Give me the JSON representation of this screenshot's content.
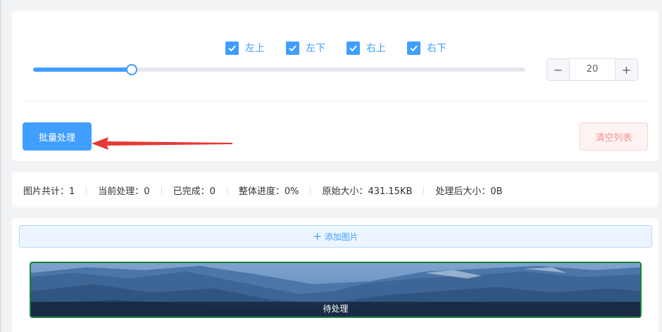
{
  "options": {
    "checkboxes": [
      {
        "label": "左上",
        "checked": true
      },
      {
        "label": "左下",
        "checked": true
      },
      {
        "label": "右上",
        "checked": true
      },
      {
        "label": "右下",
        "checked": true
      }
    ],
    "slider": {
      "value": 20,
      "min": 0,
      "max": 100
    },
    "stepper": {
      "value": "20",
      "decrement_symbol": "−",
      "increment_symbol": "+"
    }
  },
  "actions": {
    "batch_process_label": "批量处理",
    "clear_list_label": "清空列表"
  },
  "stats": {
    "total": "图片共计：1",
    "current": "当前处理：0",
    "completed": "已完成：0",
    "progress": "整体进度：0%",
    "original_size": "原始大小：431.15KB",
    "processed_size": "处理后大小：0B"
  },
  "list": {
    "add_label": "添加图片",
    "add_icon": "+",
    "items": [
      {
        "status": "待处理"
      }
    ]
  },
  "colors": {
    "primary": "#409eff",
    "danger": "#f56c6c",
    "arrow": "#e53935",
    "thumb_border": "#1a7f3c"
  }
}
